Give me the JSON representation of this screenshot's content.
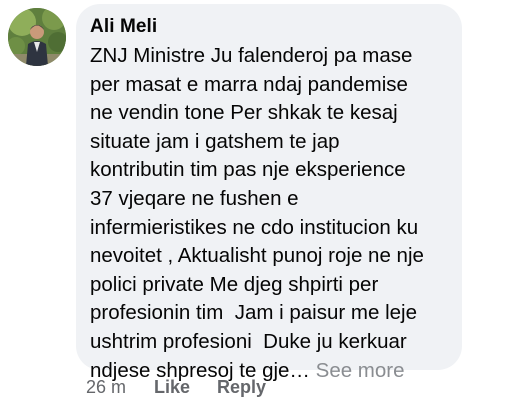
{
  "comment": {
    "author": "Ali Meli",
    "text_lines": [
      "ZNJ Ministre Ju falenderoj pa mase",
      "per masat e marra ndaj pandemise",
      "ne vendin tone Per shkak te kesaj",
      "situate jam i gatshem te jap",
      "kontributin tim pas nje eksperience",
      "37 vjeqare ne fushen e",
      "infermieristikes ne cdo institucion ku",
      "nevoitet , Aktualisht punoj roje ne nje",
      "polici private Me djeg shpirti per",
      "profesionin tim  Jam i paisur me leje",
      "ushtrim profesioni  Duke ju kerkuar"
    ],
    "last_line": "ndjese shpresoj te gje…",
    "see_more_label": "See more",
    "timestamp": "26 m",
    "like_label": "Like",
    "reply_label": "Reply"
  },
  "colors": {
    "bubble_bg": "#f0f2f5",
    "text": "#050505",
    "secondary": "#65676b",
    "see_more": "#8a8d91"
  },
  "icons": {
    "avatar": "profile-photo"
  }
}
